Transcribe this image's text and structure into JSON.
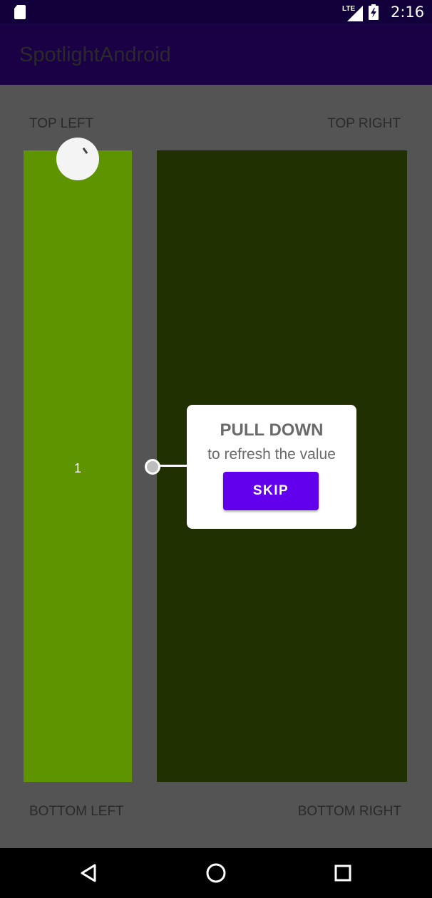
{
  "status_bar": {
    "network_label": "LTE",
    "time": "2:16",
    "icons": [
      "sd-card-icon",
      "signal-icon",
      "battery-charging-icon"
    ]
  },
  "app_bar": {
    "title": "SpotlightAndroid"
  },
  "labels": {
    "top_left": "TOP LEFT",
    "top_right": "TOP RIGHT",
    "bottom_left": "BOTTOM LEFT",
    "bottom_right": "BOTTOM RIGHT"
  },
  "panels": {
    "left_color": "#5e9400",
    "right_color": "#203000",
    "counter_value": "1"
  },
  "spotlight": {
    "title": "PULL DOWN",
    "description": "to refresh the value",
    "skip_label": "SKIP",
    "accent_color": "#6200ee"
  },
  "nav_bar": {
    "icons": [
      "back-icon",
      "home-icon",
      "recents-icon"
    ]
  }
}
